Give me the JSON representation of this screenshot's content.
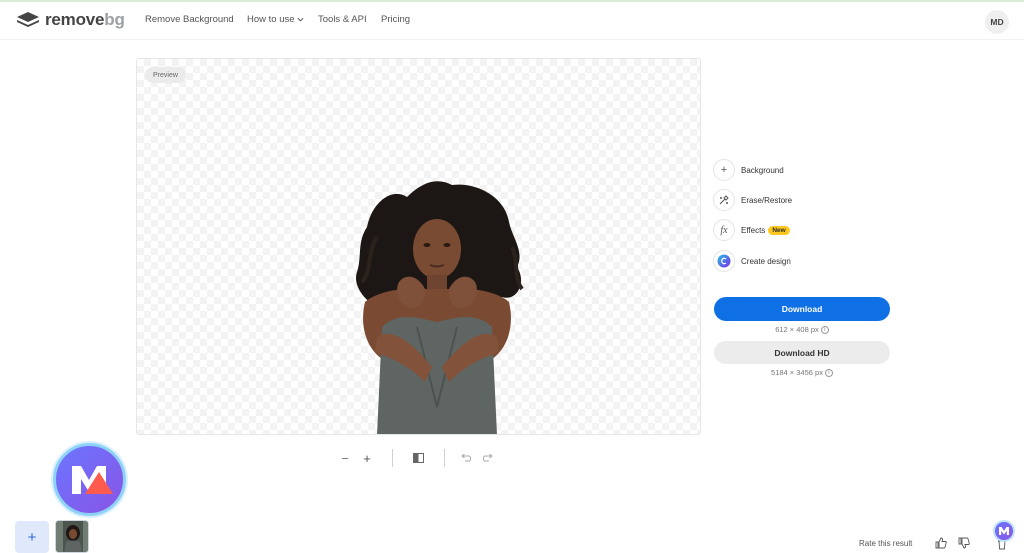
{
  "nav": {
    "logo_main": "remove",
    "logo_accent": "bg",
    "items": [
      {
        "label": "Remove Background"
      },
      {
        "label": "How to use"
      },
      {
        "label": "Tools & API"
      },
      {
        "label": "Pricing"
      }
    ],
    "user_initials": "MD"
  },
  "preview": {
    "badge": "Preview"
  },
  "toolbar": {
    "zoom_out": "−",
    "zoom_in": "+"
  },
  "tools": [
    {
      "label": "Background",
      "icon": "plus-icon"
    },
    {
      "label": "Erase/Restore",
      "icon": "brush-icon"
    },
    {
      "label": "Effects",
      "icon": "fx-icon",
      "badge": "New"
    },
    {
      "label": "Create design",
      "icon": "canva-icon"
    }
  ],
  "download": {
    "label": "Download",
    "resolution": "612 × 408 px",
    "hd_label": "Download HD",
    "hd_resolution": "5184 × 3456 px"
  },
  "bottom": {
    "add_label": "+",
    "rate_label": "Rate this result"
  },
  "colors": {
    "primary": "#0f70e6",
    "new_badge": "#ffc81e",
    "watermark": "#7a68f0"
  }
}
